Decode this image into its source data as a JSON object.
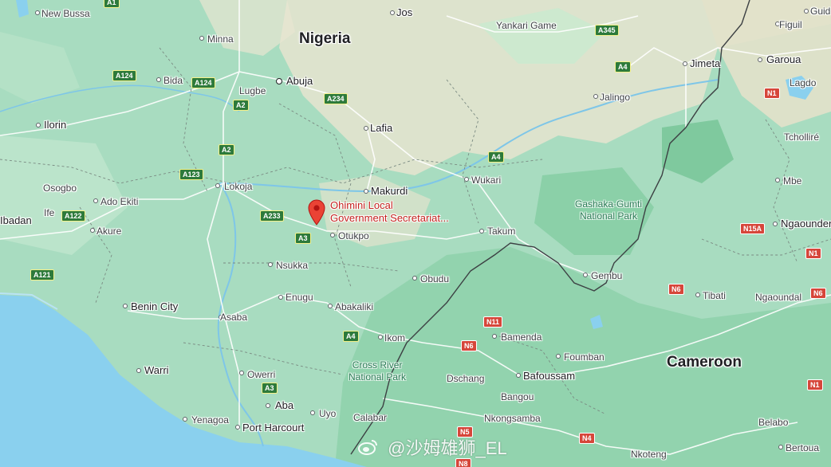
{
  "countries": [
    "Nigeria",
    "Cameroon"
  ],
  "cities": [
    {
      "name": "New Bussa"
    },
    {
      "name": "Minna"
    },
    {
      "name": "Abuja"
    },
    {
      "name": "Lugbe"
    },
    {
      "name": "Bida"
    },
    {
      "name": "Ilorin"
    },
    {
      "name": "Lafia"
    },
    {
      "name": "Jos"
    },
    {
      "name": "Yankari Game"
    },
    {
      "name": "Jimeta"
    },
    {
      "name": "Garoua"
    },
    {
      "name": "Figuil"
    },
    {
      "name": "Guid"
    },
    {
      "name": "Lagdo"
    },
    {
      "name": "Jalingo"
    },
    {
      "name": "Tcholliré"
    },
    {
      "name": "Mbe"
    },
    {
      "name": "Ngaounder"
    },
    {
      "name": "Makurdi"
    },
    {
      "name": "Wukari"
    },
    {
      "name": "Lokoja"
    },
    {
      "name": "Osogbo"
    },
    {
      "name": "Ado Ekiti"
    },
    {
      "name": "Ife"
    },
    {
      "name": "Ibadan"
    },
    {
      "name": "Akure"
    },
    {
      "name": "Otukpo"
    },
    {
      "name": "Takum"
    },
    {
      "name": "Nsukka"
    },
    {
      "name": "Obudu"
    },
    {
      "name": "Gembu"
    },
    {
      "name": "Enugu"
    },
    {
      "name": "Abakaliki"
    },
    {
      "name": "Benin City"
    },
    {
      "name": "Tibati"
    },
    {
      "name": "Ngaoundal"
    },
    {
      "name": "Asaba"
    },
    {
      "name": "Ikom"
    },
    {
      "name": "Bamenda"
    },
    {
      "name": "Foumban"
    },
    {
      "name": "Owerri"
    },
    {
      "name": "Warri"
    },
    {
      "name": "Dschang"
    },
    {
      "name": "Bafoussam"
    },
    {
      "name": "Bangou"
    },
    {
      "name": "Aba"
    },
    {
      "name": "Uyo"
    },
    {
      "name": "Calabar"
    },
    {
      "name": "Nkongsamba"
    },
    {
      "name": "Yenagoa"
    },
    {
      "name": "Port Harcourt"
    },
    {
      "name": "Belabo"
    },
    {
      "name": "Bertoua"
    },
    {
      "name": "Nkoteng"
    }
  ],
  "parks": [
    {
      "name": "Gashaka-Gumti\nNational Park"
    },
    {
      "name": "Cross River\nNational Park"
    }
  ],
  "roads": [
    "A1",
    "A345",
    "A4",
    "A124",
    "A124",
    "A2",
    "A234",
    "N1",
    "A2",
    "A123",
    "A4",
    "A233",
    "A122",
    "A3",
    "N15A",
    "N1",
    "A121",
    "N6",
    "N6",
    "N11",
    "A4",
    "N6",
    "A3",
    "N1",
    "N5",
    "N4",
    "N8"
  ],
  "pin": {
    "label_line1": "Ohimini Local",
    "label_line2": "Government Secretariat..."
  },
  "watermark": "@沙姆雄狮_EL",
  "colors": {
    "land": "#a8dcc0",
    "land_light": "#c6e9d3",
    "land_dark": "#88cfa8",
    "arid": "#e9e6d3",
    "water": "#8ad0ee",
    "pin": "#ea4335",
    "label_red": "#c5221f"
  }
}
